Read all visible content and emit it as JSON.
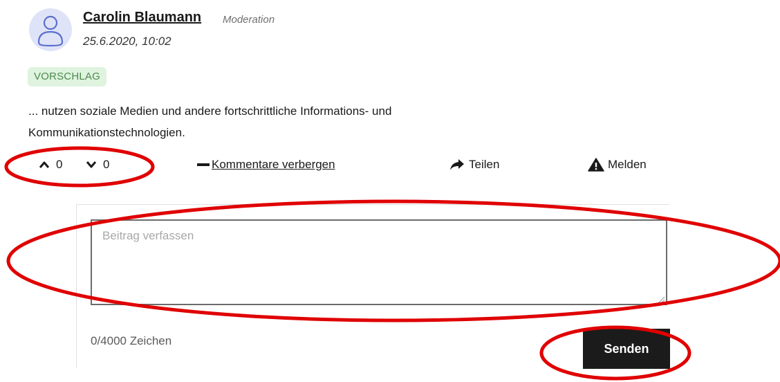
{
  "post": {
    "author": "Carolin Blaumann",
    "role": "Moderation",
    "date": "25.6.2020, 10:02",
    "badge": "VORSCHLAG",
    "text_line1": "... nutzen soziale Medien und andere fortschrittliche Informations- und",
    "text_line2": "Kommunikationstechnologien."
  },
  "actions": {
    "upvotes": "0",
    "downvotes": "0",
    "toggle_comments_label": "Kommentare verbergen",
    "share_label": "Teilen",
    "report_label": "Melden"
  },
  "comment_form": {
    "placeholder": "Beitrag verfassen",
    "value": "",
    "char_counter": "0/4000 Zeichen",
    "submit_label": "Senden"
  },
  "icons": {
    "avatar": "user-icon",
    "upvote": "chevron-up-icon",
    "downvote": "chevron-down-icon",
    "toggle": "minus-icon",
    "share": "share-arrow-icon",
    "report": "warning-triangle-icon"
  },
  "colors": {
    "badge_bg": "#dff3df",
    "badge_text": "#4c8a4c",
    "avatar_bg": "#dfe3f7",
    "avatar_stroke": "#5b6fcf",
    "button_bg": "#1b1b1b",
    "annotation": "#e00000"
  }
}
